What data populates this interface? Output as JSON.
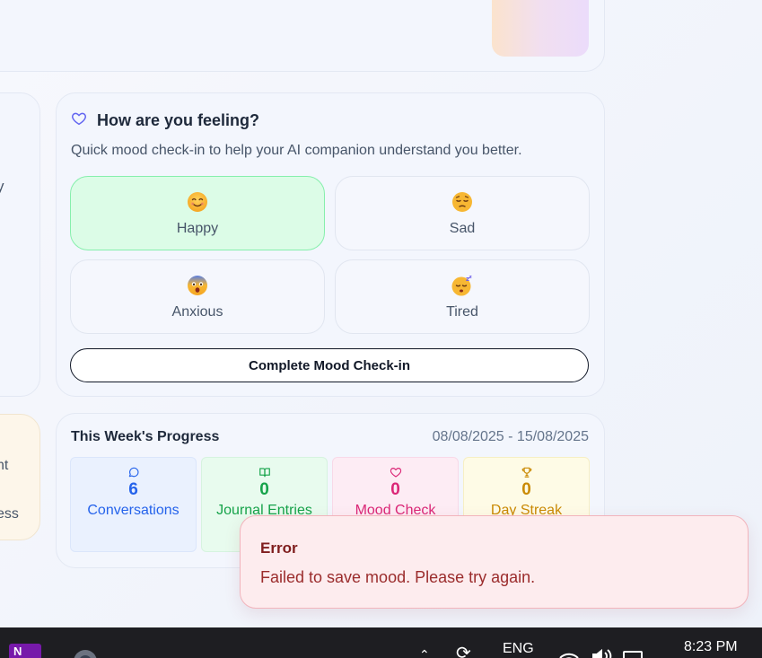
{
  "mood_card": {
    "title": "How are you feeling?",
    "subtitle": "Quick mood check-in to help your AI companion understand you better.",
    "options": [
      {
        "label": "Happy",
        "icon": "smiling-face-icon",
        "selected": true
      },
      {
        "label": "Sad",
        "icon": "pensive-face-icon",
        "selected": false
      },
      {
        "label": "Anxious",
        "icon": "fearful-face-icon",
        "selected": false
      },
      {
        "label": "Tired",
        "icon": "sleeping-face-icon",
        "selected": false
      }
    ],
    "submit_label": "Complete Mood Check-in"
  },
  "left_panels": {
    "panel1_fragment": "y",
    "panel2_fragment1": "nt",
    "panel2_fragment2": "ess"
  },
  "progress": {
    "title": "This Week's Progress",
    "date_range": "08/08/2025 - 15/08/2025",
    "stats": [
      {
        "value": "6",
        "label": "Conversations",
        "icon": "chat-bubble-icon",
        "color": "#2563eb"
      },
      {
        "value": "0",
        "label": "Journal Entries",
        "icon": "book-icon",
        "color": "#16a34a"
      },
      {
        "value": "0",
        "label": "Mood Check",
        "icon": "heart-icon",
        "color": "#db2777"
      },
      {
        "value": "0",
        "label": "Day Streak",
        "icon": "trophy-icon",
        "color": "#ca8a04"
      }
    ]
  },
  "toast": {
    "title": "Error",
    "message": "Failed to save mood. Please try again."
  },
  "taskbar": {
    "language": "ENG",
    "time": "8:23 PM",
    "onenote_letter": "N"
  },
  "colors": {
    "accent_heart": "#6366f1",
    "selected_mood_bg": "#dcfce7",
    "error_bg": "#fdecee"
  }
}
